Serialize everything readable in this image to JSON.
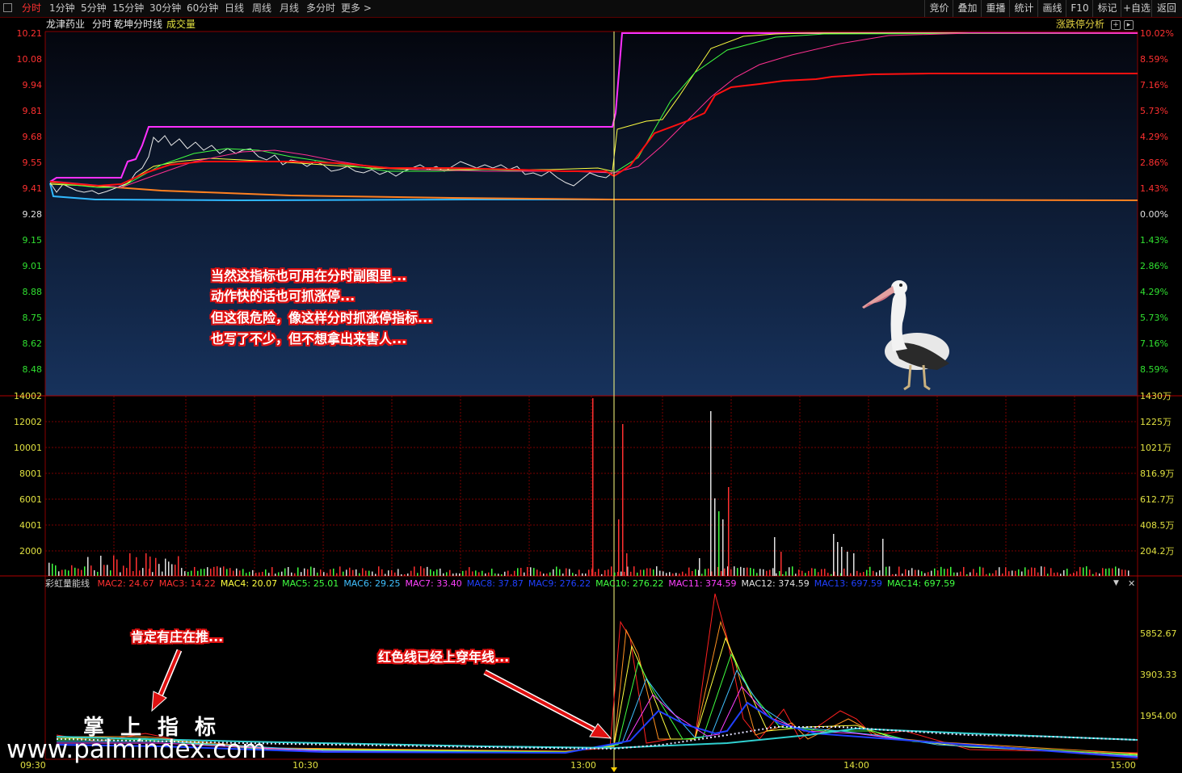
{
  "toolbar": {
    "left_tabs": [
      "分时",
      "1分钟",
      "5分钟",
      "15分钟",
      "30分钟",
      "60分钟",
      "日线",
      "周线",
      "月线",
      "多分时",
      "更多 >"
    ],
    "right_buttons": [
      "竞价",
      "叠加",
      "重播",
      "统计",
      "画线",
      "F10",
      "标记",
      "+自选",
      "返回"
    ]
  },
  "header": {
    "stock_name": "龙津药业",
    "chart_mode": "分时",
    "indicator_name": "乾坤分时线",
    "volume_label": "成交量",
    "right_label": "涨跌停分析"
  },
  "price_axis": {
    "left": [
      "10.21",
      "10.08",
      "9.94",
      "9.81",
      "9.68",
      "9.55",
      "9.41",
      "9.28",
      "9.15",
      "9.01",
      "8.88",
      "8.75",
      "8.62",
      "8.48"
    ],
    "right": [
      "10.02%",
      "8.59%",
      "7.16%",
      "5.73%",
      "4.29%",
      "2.86%",
      "1.43%",
      "0.00%",
      "1.43%",
      "2.86%",
      "4.29%",
      "5.73%",
      "7.16%",
      "8.59%"
    ]
  },
  "volume_axis": {
    "left": [
      "14002",
      "12002",
      "10001",
      "8001",
      "6001",
      "4001",
      "2000"
    ],
    "right": [
      "1430万",
      "1225万",
      "1021万",
      "816.9万",
      "612.7万",
      "408.5万",
      "204.2万"
    ]
  },
  "mac_indicator": {
    "name": "彩虹量能线",
    "items": [
      {
        "label": "MAC2: 24.67",
        "color": "#ff3030"
      },
      {
        "label": "MAC3: 14.22",
        "color": "#ff3030"
      },
      {
        "label": "MAC4: 20.07",
        "color": "#ffff40"
      },
      {
        "label": "MAC5: 25.01",
        "color": "#40ff40"
      },
      {
        "label": "MAC6: 29.25",
        "color": "#40c0ff"
      },
      {
        "label": "MAC7: 33.40",
        "color": "#ff40ff"
      },
      {
        "label": "MAC8: 37.87",
        "color": "#2040ff"
      },
      {
        "label": "MAC9: 276.22",
        "color": "#2040ff"
      },
      {
        "label": "MAC10: 276.22",
        "color": "#40ff40"
      },
      {
        "label": "MAC11: 374.59",
        "color": "#ff40ff"
      },
      {
        "label": "MAC12: 374.59",
        "color": "#e0e0e0"
      },
      {
        "label": "MAC13: 697.59",
        "color": "#2040ff"
      },
      {
        "label": "MAC14: 697.59",
        "color": "#40ff40"
      }
    ],
    "right_axis": [
      "5852.67",
      "3903.33",
      "1954.00"
    ]
  },
  "time_axis": [
    "09:30",
    "10:30",
    "13:00",
    "14:00",
    "15:00"
  ],
  "annotations": {
    "main_lines": [
      "当然这指标也可用在分时副图里...",
      "动作快的话也可抓涨停...",
      "但这很危险，像这样分时抓涨停指标...",
      "也写了不少，但不想拿出来害人..."
    ],
    "arrow1": "肯定有庄在推...",
    "arrow2": "红色线已经上穿年线..."
  },
  "watermark": {
    "title": "掌上指标",
    "url": "www.palmindex.com"
  },
  "colors": {
    "axis_red": "#ff3030",
    "axis_green": "#30e030",
    "grid": "#7a0000",
    "price_magenta": "#ff30ff",
    "ma_red": "#ff1010",
    "cursor": "#ffff80"
  }
}
